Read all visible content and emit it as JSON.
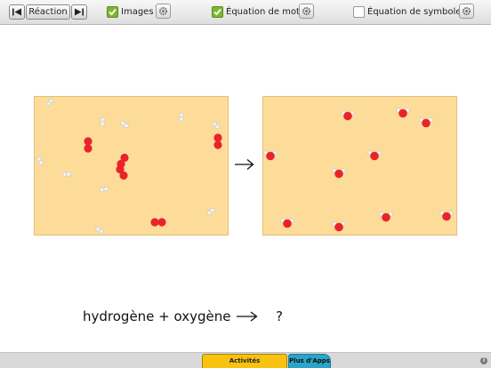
{
  "toolbar": {
    "prev_icon": "step-back-icon",
    "reaction_label": "Réaction",
    "next_icon": "step-forward-icon",
    "options": [
      {
        "label": "Images",
        "checked": true
      },
      {
        "label": "Équation de mot",
        "checked": true
      },
      {
        "label": "Équation de symbole",
        "checked": false
      }
    ]
  },
  "main": {
    "equation_text": "hydrogène + oxygène",
    "arrow_glyph": "→",
    "unknown": "?"
  },
  "bottom": {
    "tab_activities": "Activités",
    "tab_more": "Plus d'Apps",
    "info_glyph": "i"
  },
  "colors": {
    "panel_bg": "#fddb98",
    "oxygen": "#e8242a",
    "hydrogen": "#f2f2f2",
    "check_green": "#7cb82f",
    "tab_yellow": "#f7c210",
    "tab_blue": "#2aa4c8"
  }
}
